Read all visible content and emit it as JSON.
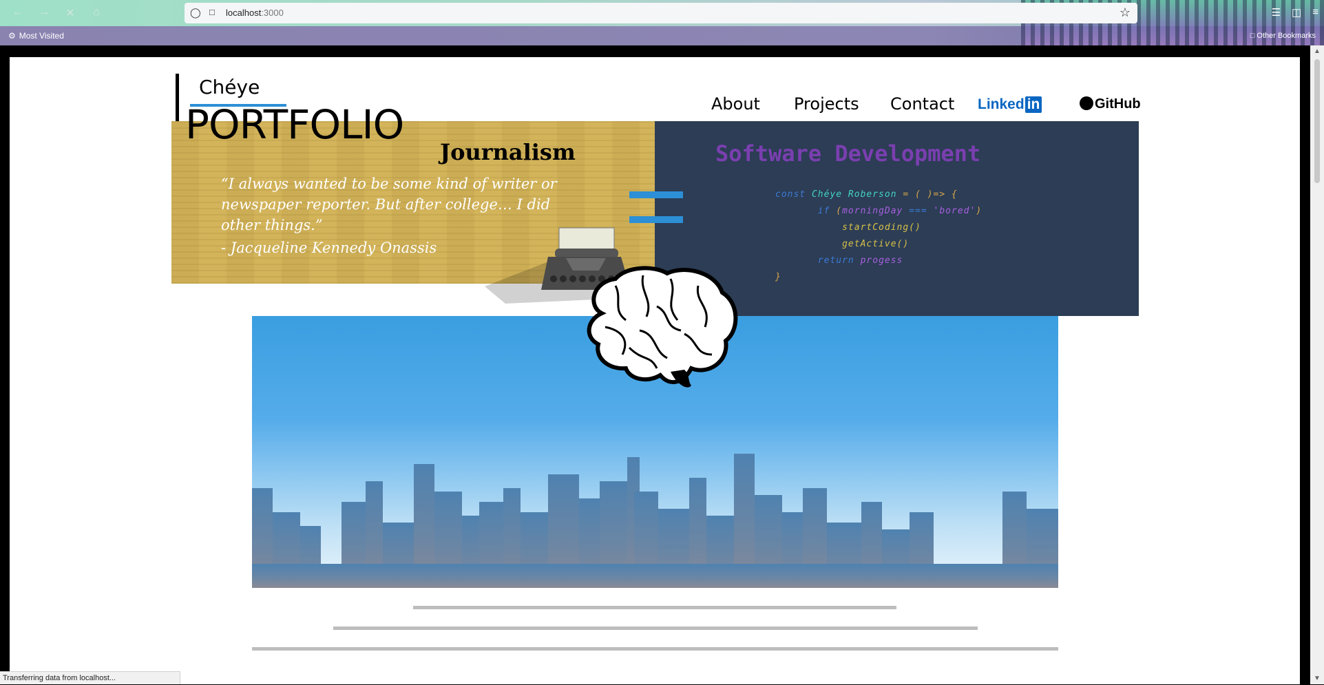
{
  "browser": {
    "url_host": "localhost",
    "url_port": ":3000",
    "bookmarks_left": "Most Visited",
    "bookmarks_right": "Other Bookmarks",
    "status": "Transferring data from localhost..."
  },
  "logo": {
    "name": "Chéye",
    "title": "PORTFOLIO"
  },
  "nav": {
    "about": "About",
    "projects": "Projects",
    "contact": "Contact",
    "linkedin_word": "Linked",
    "linkedin_in": "in",
    "github": "GitHub"
  },
  "journalism": {
    "title": "Journalism",
    "quote": "“I always wanted to be some kind of writer or newspaper reporter. But after college… I did other things.”",
    "author": "- Jacqueline Kennedy Onassis"
  },
  "dev": {
    "title": "Software Development",
    "code": {
      "l1_const": "const",
      "l1_name": "Chéye Roberson",
      "l1_rest": " = ( )=> {",
      "l2_if": "if",
      "l2_open": " (",
      "l2_var": "morningDay",
      "l2_eq": " === ",
      "l2_str": "'bored'",
      "l2_close": ")",
      "l3": "startCoding()",
      "l4": "getActive()",
      "l5_return": "return",
      "l5_val": "progess",
      "l6": "}"
    }
  },
  "colors": {
    "accent": "#2d8fd6",
    "journalism_bg": "#d3b45a",
    "dev_bg": "#2c3d55",
    "dev_title": "#7a3fb0",
    "sky_top": "#3a9ee0",
    "sky_bottom": "#e8f4fb"
  },
  "icons": {
    "back": "arrow-left-icon",
    "forward": "arrow-right-icon",
    "stop": "close-icon",
    "home": "home-icon",
    "shield": "shield-icon",
    "star": "star-icon",
    "gear": "gear-icon",
    "folder": "folder-icon"
  }
}
